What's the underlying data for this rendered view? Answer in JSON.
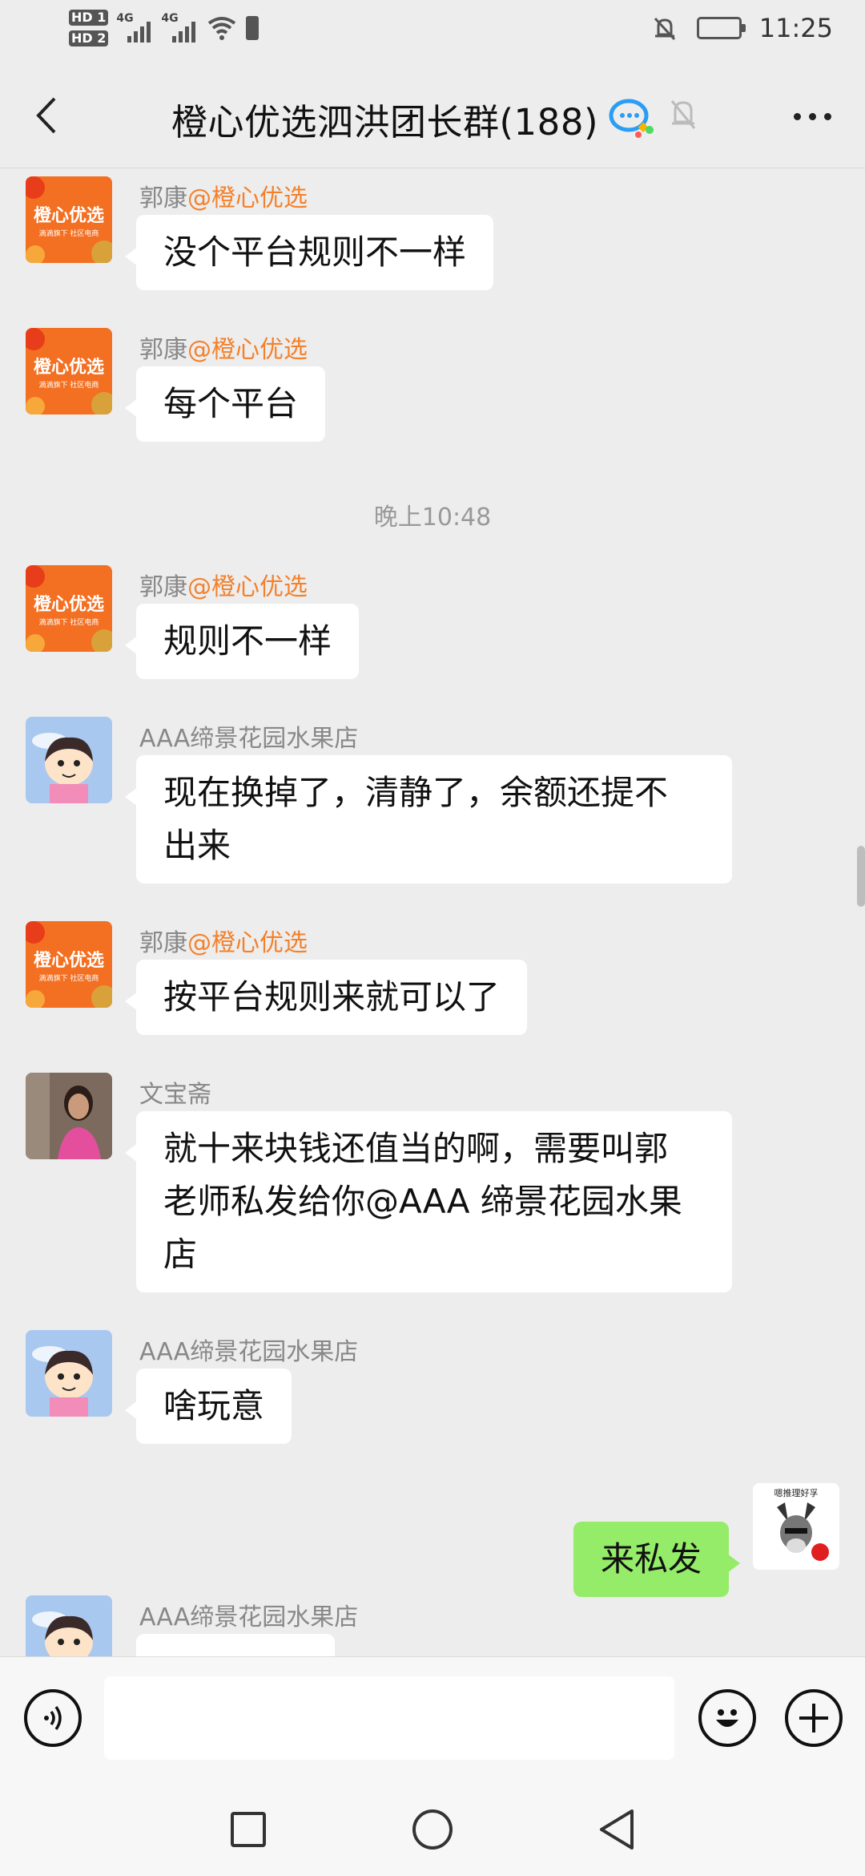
{
  "status_bar": {
    "hd1": "HD 1",
    "hd2": "HD 2",
    "net1": "4G",
    "net2": "4G",
    "time": "11:25"
  },
  "header": {
    "back_icon": "chevron-left-icon",
    "title": "橙心优选泗洪团长群(188)",
    "group_icon": "chat-bubbles-icon",
    "mute_icon": "bell-off-icon",
    "more_icon": "more-dots-icon"
  },
  "messages": [
    {
      "sender": "郭康",
      "mention": "@橙心优选",
      "text": "没个平台规则不一样",
      "avatar": "chengxin-logo"
    },
    {
      "sender": "郭康",
      "mention": "@橙心优选",
      "text": "每个平台",
      "avatar": "chengxin-logo"
    },
    {
      "time_divider": "晚上10:48"
    },
    {
      "sender": "郭康",
      "mention": "@橙心优选",
      "text": "规则不一样",
      "avatar": "chengxin-logo"
    },
    {
      "sender": "AAA缔景花园水果店",
      "text_lines": [
        "现在换掉了，清静了，余额还提不",
        "出来"
      ],
      "avatar": "cartoon-girl"
    },
    {
      "sender": "郭康",
      "mention": "@橙心优选",
      "text": "按平台规则来就可以了",
      "avatar": "chengxin-logo"
    },
    {
      "sender": "文宝斋",
      "text_lines": [
        "就十来块钱还值当的啊，需要叫郭",
        "老师私发给你@AAA 缔景花园水果",
        "店"
      ],
      "avatar": "person-photo"
    },
    {
      "sender": "AAA缔景花园水果店",
      "text": "啥玩意",
      "avatar": "cartoon-girl"
    },
    {
      "own": true,
      "text": "来私发",
      "avatar": "donkey-sticker"
    },
    {
      "sender": "AAA缔景花园水果店",
      "text": "",
      "avatar": "cartoon-girl"
    }
  ],
  "avatar_text": {
    "chengxin_brand": "橙心优选",
    "chengxin_sub": "滴滴旗下 社区电商",
    "donkey_caption": "嗯推理好孚"
  },
  "colors": {
    "accent_mention": "#f3812c",
    "own_bubble": "#95ec69",
    "chengxin_orange": "#f36f21"
  },
  "input_bar": {
    "voice_icon": "voice-icon",
    "emoji_icon": "emoji-icon",
    "plus_icon": "plus-icon",
    "placeholder": ""
  },
  "nav_bar": {
    "recent_icon": "square-icon",
    "home_icon": "circle-icon",
    "back_icon": "triangle-back-icon"
  }
}
